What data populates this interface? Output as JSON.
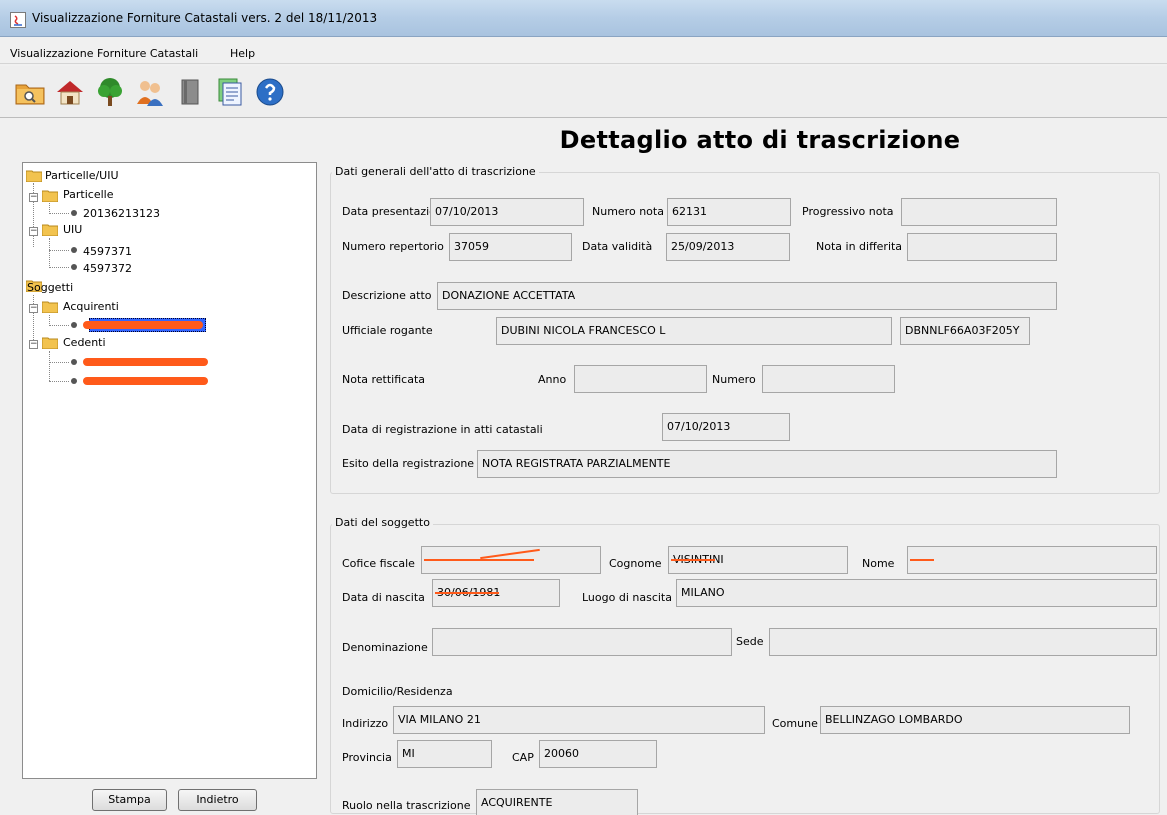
{
  "window": {
    "title": "Visualizzazione Forniture Catastali vers. 2 del 18/11/2013"
  },
  "menu": {
    "items": [
      "Visualizzazione Forniture Catastali",
      "Help"
    ]
  },
  "toolbar": {
    "icons": [
      "folder-search-icon",
      "house-icon",
      "tree-icon",
      "people-icon",
      "book-icon",
      "document-icon",
      "help-icon"
    ]
  },
  "page": {
    "heading": "Dettaglio atto di trascrizione"
  },
  "tree": {
    "root_particelle_uiu": "Particelle/UIU",
    "particelle": "Particelle",
    "particella_1": "20136213123",
    "uiu": "UIU",
    "uiu_1": "4597371",
    "uiu_2": "4597372",
    "soggetti": "Soggetti",
    "acquirenti": "Acquirenti",
    "cedenti": "Cedenti"
  },
  "buttons": {
    "stampa": "Stampa",
    "indietro": "Indietro"
  },
  "atto": {
    "title": "Dati generali dell'atto di trascrizione",
    "data_presentazione_label": "Data presentazione",
    "data_presentazione": "07/10/2013",
    "numero_nota_label": "Numero nota",
    "numero_nota": "62131",
    "progressivo_nota_label": "Progressivo nota",
    "progressivo_nota": "",
    "numero_repertorio_label": "Numero repertorio",
    "numero_repertorio": "37059",
    "data_validita_label": "Data validità",
    "data_validita": "25/09/2013",
    "nota_differita_label": "Nota in differita",
    "nota_differita": "",
    "descrizione_label": "Descrizione atto",
    "descrizione": "DONAZIONE ACCETTATA",
    "ufficiale_label": "Ufficiale rogante",
    "ufficiale_nome": "DUBINI NICOLA FRANCESCO L",
    "ufficiale_cf": "DBNNLF66A03F205Y",
    "nota_rettificata_label": "Nota rettificata",
    "anno_label": "Anno",
    "anno": "",
    "numero_label": "Numero",
    "numero": "",
    "data_registrazione_label": "Data di registrazione in atti catastali",
    "data_registrazione": "07/10/2013",
    "esito_label": "Esito della registrazione",
    "esito": "NOTA REGISTRATA PARZIALMENTE"
  },
  "soggetto": {
    "title": "Dati del soggetto",
    "cf_label": "Cofice fiscale",
    "cognome_label": "Cognome",
    "cognome": "VISINTINI",
    "nome_label": "Nome",
    "data_nascita_label": "Data di nascita",
    "data_nascita": "30/06/1981",
    "luogo_nascita_label": "Luogo di nascita",
    "luogo_nascita": "MILANO",
    "denominazione_label": "Denominazione",
    "denominazione": "",
    "sede_label": "Sede",
    "sede": "",
    "domicilio_label": "Domicilio/Residenza",
    "indirizzo_label": "Indirizzo",
    "indirizzo": "VIA MILANO 21",
    "comune_label": "Comune",
    "comune": "BELLINZAGO LOMBARDO",
    "provincia_label": "Provincia",
    "provincia": "MI",
    "cap_label": "CAP",
    "cap": "20060",
    "ruolo_label": "Ruolo nella trascrizione",
    "ruolo": "ACQUIRENTE"
  },
  "colors": {
    "redaction": "#ff5a1a",
    "selection": "#3366ff",
    "title_bar": "#b5cde6"
  }
}
